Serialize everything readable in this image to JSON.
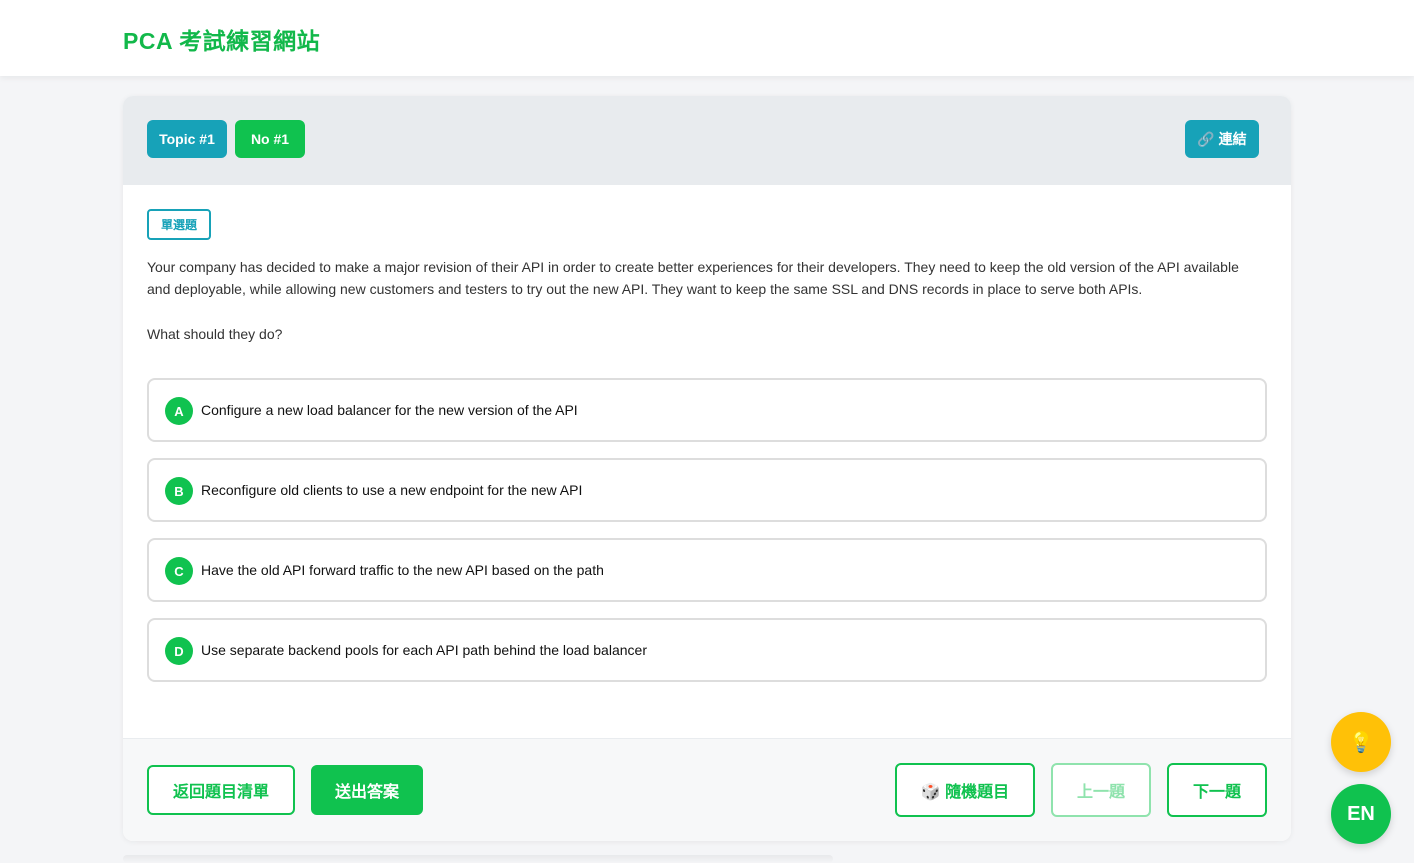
{
  "header": {
    "brand": "PCA 考試練習網站"
  },
  "question_card": {
    "topic_label": "Topic #1",
    "number_label": "No #1",
    "link_label": "🔗 連結",
    "type_tag": "單選題",
    "question_text": "Your company has decided to make a major revision of their API in order to create better experiences for their developers. They need to keep the old version of the API available and deployable, while allowing new customers and testers to try out the new API. They want to keep the same SSL and DNS records in place to serve both APIs.",
    "prompt": "What should they do?",
    "options": [
      {
        "letter": "A",
        "text": "Configure a new load balancer for the new version of the API"
      },
      {
        "letter": "B",
        "text": "Reconfigure old clients to use a new endpoint for the new API"
      },
      {
        "letter": "C",
        "text": "Have the old API forward traffic to the new API based on the path"
      },
      {
        "letter": "D",
        "text": "Use separate backend pools for each API path behind the load balancer"
      }
    ]
  },
  "footer": {
    "back_label": "返回題目清單",
    "submit_label": "送出答案",
    "random_label": "🎲 隨機題目",
    "prev_label": "上一題",
    "next_label": "下一題"
  },
  "floating": {
    "hint_icon": "lightbulb-icon",
    "hint_glyph": "💡",
    "lang_label": "EN"
  },
  "colors": {
    "brand_green": "#10c24f",
    "info_teal": "#17a2b8",
    "hint_yellow": "#ffc107"
  }
}
